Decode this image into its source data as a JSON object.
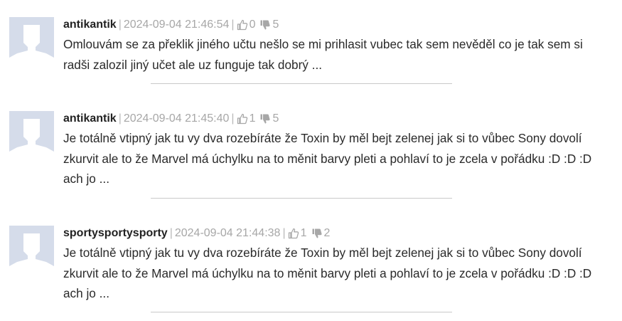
{
  "comments": [
    {
      "author": "antikantik",
      "date": "2024-09-04 21:46:54",
      "likes": "0",
      "dislikes": "5",
      "text": "Omlouvám se za překlik jiného učtu nešlo se mi prihlasit vubec tak sem nevěděl co je tak sem si radši zalozil jiný učet ale uz funguje tak dobrý ..."
    },
    {
      "author": "antikantik",
      "date": "2024-09-04 21:45:40",
      "likes": "1",
      "dislikes": "5",
      "text": "Je totálně vtipný jak tu vy dva rozebíráte že Toxin by měl bejt zelenej jak si to vůbec Sony dovolí zkurvit ale to že Marvel má úchylku na to měnit barvy pleti a pohlaví to je zcela v pořádku :D :D :D ach jo ..."
    },
    {
      "author": "sportysportysporty",
      "date": "2024-09-04 21:44:38",
      "likes": "1",
      "dislikes": "2",
      "text": "Je totálně vtipný jak tu vy dva rozebíráte že Toxin by měl bejt zelenej jak si to vůbec Sony dovolí zkurvit ale to že Marvel má úchylku na to měnit barvy pleti a pohlaví to je zcela v pořádku :D :D :D ach jo ..."
    }
  ],
  "separator": "|",
  "icons": {
    "like": "thumbs-up-outline-icon",
    "dislike": "thumbs-down-filled-icon",
    "avatar": "default-avatar-silhouette"
  },
  "colors": {
    "avatar_bg": "#d5dcea",
    "avatar_figure": "#ffffff",
    "meta_text": "#a7a7a7",
    "author_text": "#222222",
    "body_text": "#2a2a2a",
    "divider": "#c9c9c9"
  }
}
